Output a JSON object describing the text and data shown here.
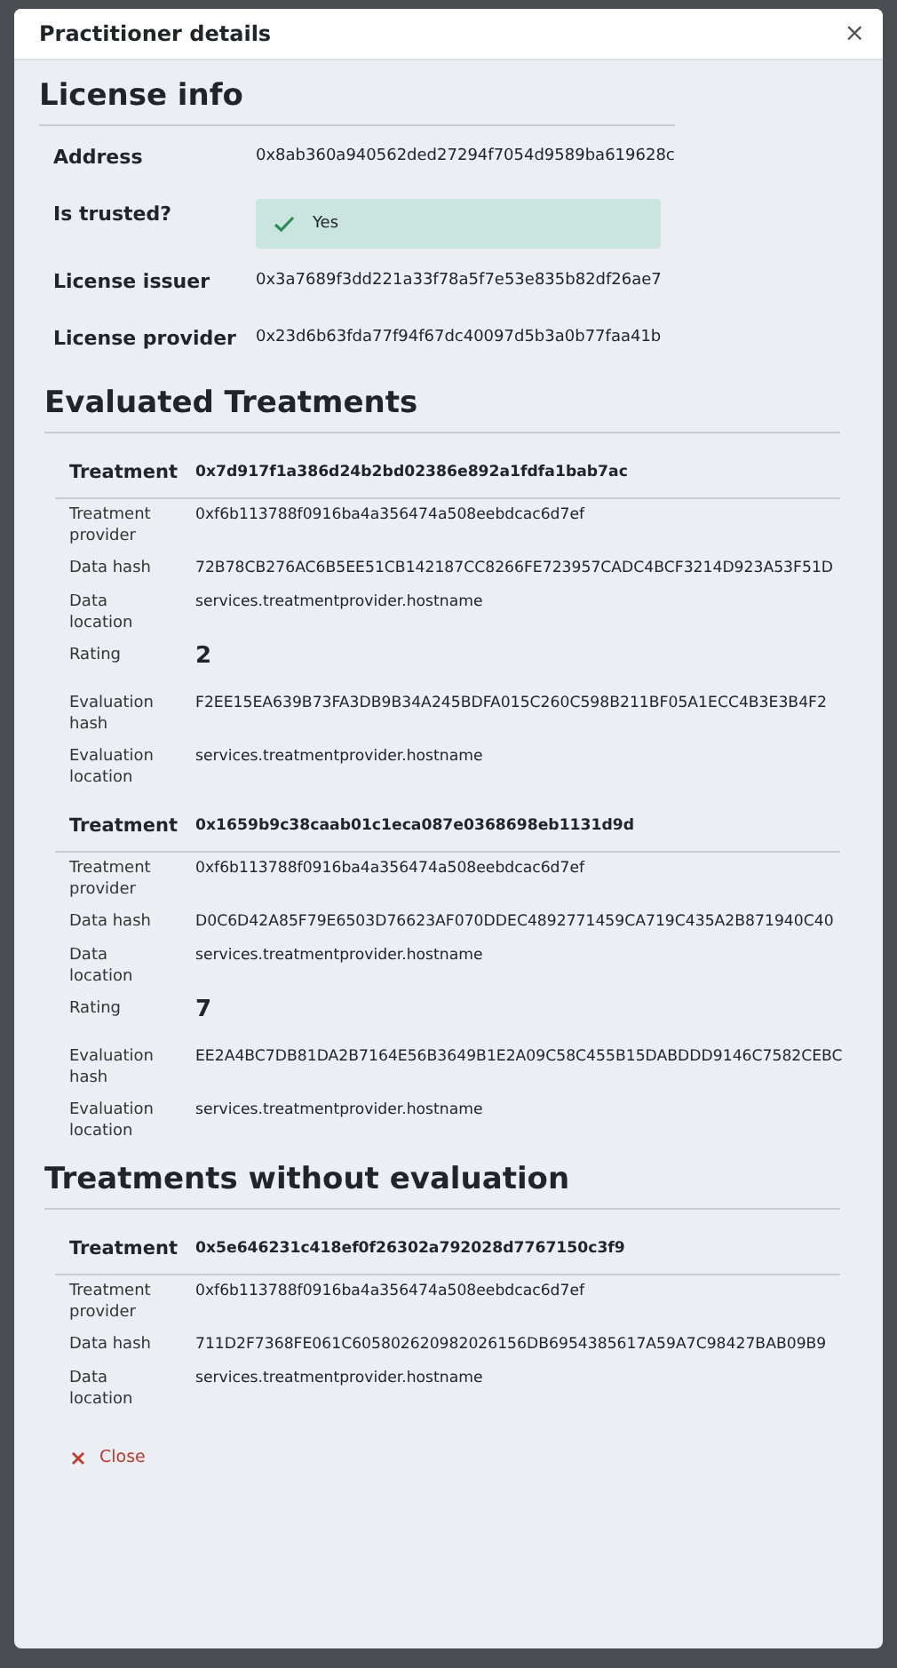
{
  "dialog": {
    "title": "Practitioner details",
    "close_icon": "×"
  },
  "license_info": {
    "heading": "License info",
    "rows": [
      {
        "kind": "text",
        "label": "Address",
        "value": "0x8ab360a940562ded27294f7054d9589ba619628c"
      },
      {
        "kind": "badge",
        "label": "Is trusted?",
        "value": "Yes"
      },
      {
        "kind": "text",
        "label": "License issuer",
        "value": "0x3a7689f3dd221a33f78a5f7e53e835b82df26ae7"
      },
      {
        "kind": "text",
        "label": "License provider",
        "value": "0x23d6b63fda77f94f67dc40097d5b3a0b77faa41b"
      }
    ]
  },
  "evaluated_treatments": {
    "heading": "Evaluated Treatments",
    "treatments": [
      {
        "label": "Treatment",
        "id": "0x7d917f1a386d24b2bd02386e892a1fdfa1bab7ac",
        "fields": [
          {
            "kind": "text",
            "label": "Treatment provider",
            "value": "0xf6b113788f0916ba4a356474a508eebdcac6d7ef"
          },
          {
            "kind": "text",
            "label": "Data hash",
            "value": "72B78CB276AC6B5EE51CB142187CC8266FE723957CADC4BCF3214D923A53F51D"
          },
          {
            "kind": "text",
            "label": "Data location",
            "value": "services.treatmentprovider.hostname"
          },
          {
            "kind": "rating",
            "label": "Rating",
            "value": "2"
          },
          {
            "kind": "text",
            "label": "Evaluation hash",
            "value": "F2EE15EA639B73FA3DB9B34A245BDFA015C260C598B211BF05A1ECC4B3E3B4F2"
          },
          {
            "kind": "text",
            "label": "Evaluation location",
            "value": "services.treatmentprovider.hostname"
          }
        ]
      },
      {
        "label": "Treatment",
        "id": "0x1659b9c38caab01c1eca087e0368698eb1131d9d",
        "fields": [
          {
            "kind": "text",
            "label": "Treatment provider",
            "value": "0xf6b113788f0916ba4a356474a508eebdcac6d7ef"
          },
          {
            "kind": "text",
            "label": "Data hash",
            "value": "D0C6D42A85F79E6503D76623AF070DDEC4892771459CA719C435A2B871940C40"
          },
          {
            "kind": "text",
            "label": "Data location",
            "value": "services.treatmentprovider.hostname"
          },
          {
            "kind": "rating",
            "label": "Rating",
            "value": "7"
          },
          {
            "kind": "text",
            "label": "Evaluation hash",
            "value": "EE2A4BC7DB81DA2B7164E56B3649B1E2A09C58C455B15DABDDD9146C7582CEBC"
          },
          {
            "kind": "text",
            "label": "Evaluation location",
            "value": "services.treatmentprovider.hostname"
          }
        ]
      }
    ]
  },
  "treatments_without_evaluation": {
    "heading": "Treatments without evaluation",
    "treatments": [
      {
        "label": "Treatment",
        "id": "0x5e646231c418ef0f26302a792028d7767150c3f9",
        "fields": [
          {
            "kind": "text",
            "label": "Treatment provider",
            "value": "0xf6b113788f0916ba4a356474a508eebdcac6d7ef"
          },
          {
            "kind": "text",
            "label": "Data hash",
            "value": "711D2F7368FE061C605802620982026156DB6954385617A59A7C98427BAB09B9"
          },
          {
            "kind": "text",
            "label": "Data location",
            "value": "services.treatmentprovider.hostname"
          }
        ]
      }
    ]
  },
  "close_button": {
    "label": "Close"
  }
}
